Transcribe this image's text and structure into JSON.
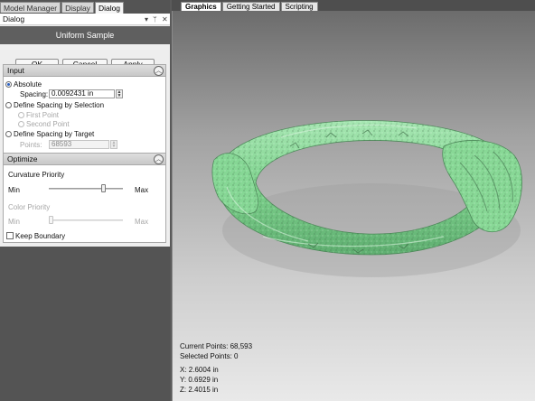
{
  "left_tabs": [
    "Model Manager",
    "Display",
    "Dialog"
  ],
  "dialog": {
    "title": "Dialog",
    "pin_icon": "pin-icon",
    "close_icon": "close-icon",
    "banner": "Uniform Sample",
    "buttons": {
      "ok": "OK",
      "cancel": "Cancel",
      "apply": "Apply"
    }
  },
  "input_group": {
    "title": "Input",
    "absolute_label": "Absolute",
    "spacing_label": "Spacing:",
    "spacing_value": "0.0092431 in",
    "by_selection_label": "Define Spacing by Selection",
    "first_point_label": "First Point",
    "second_point_label": "Second Point",
    "by_target_label": "Define Spacing by Target",
    "points_label": "Points:",
    "points_value": "68593"
  },
  "optimize_group": {
    "title": "Optimize",
    "curvature_label": "Curvature Priority",
    "curvature_level": 0.75,
    "color_label": "Color Priority",
    "color_level": 0.0,
    "min_label": "Min",
    "max_label": "Max",
    "keep_boundary_label": "Keep Boundary"
  },
  "viewport_tabs": [
    "Graphics",
    "Getting Started",
    "Scripting"
  ],
  "viewport": {
    "current_points": "Current Points: 68,593",
    "selected_points": "Selected Points: 0",
    "x": "X:  2.6004 in",
    "y": "Y:  0.6929 in",
    "z": "Z:  2.4015 in"
  },
  "colors": {
    "model_green": "#7ed28d",
    "banner_gray": "#5f5f5f",
    "panel_gray": "#545454"
  }
}
